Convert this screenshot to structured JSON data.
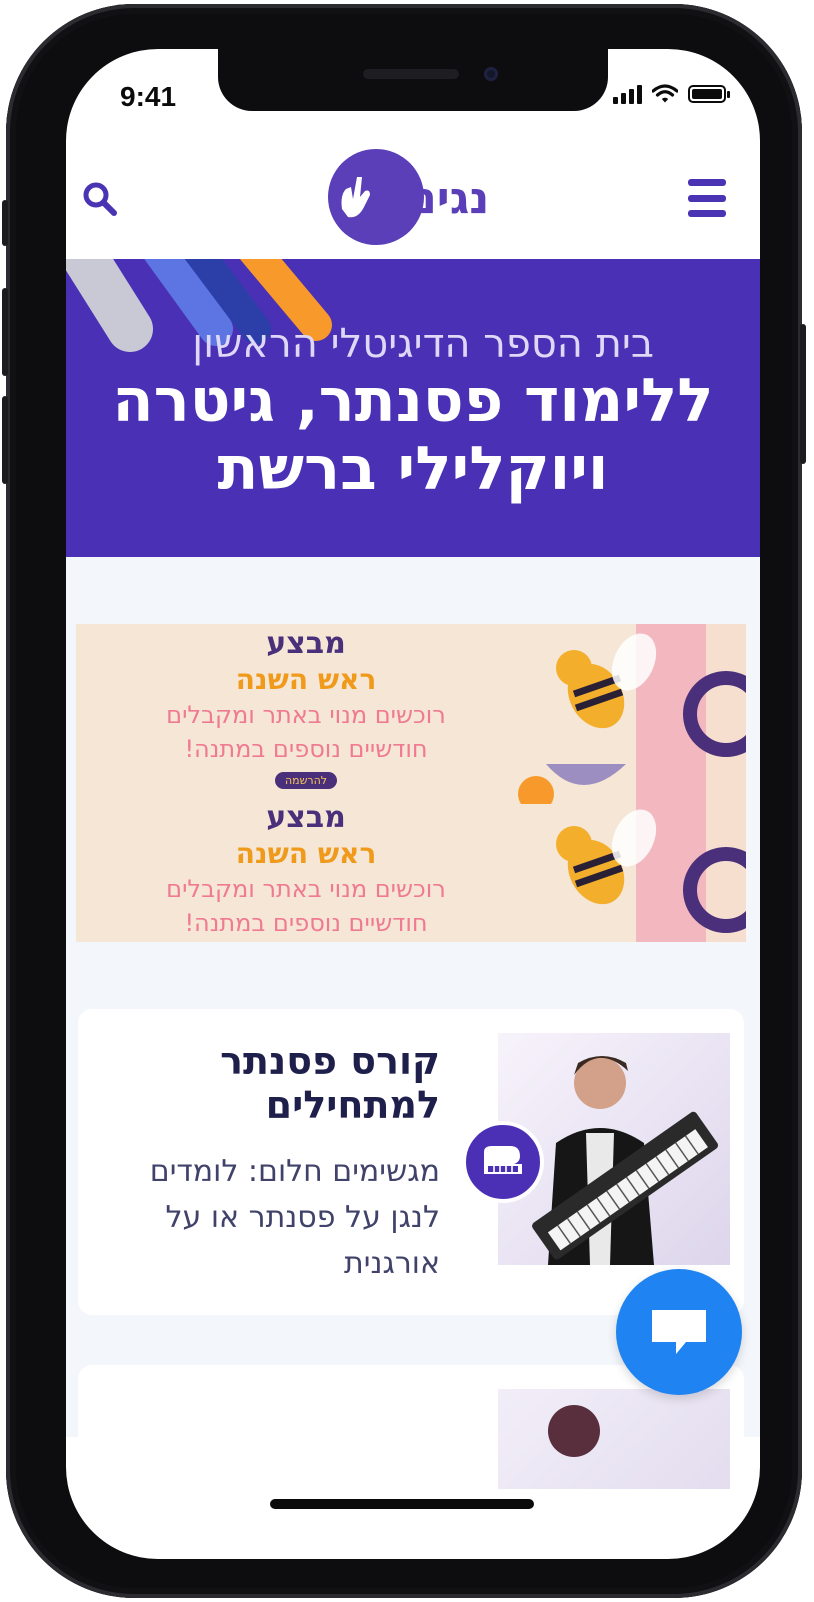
{
  "status_bar": {
    "time": "9:41"
  },
  "header": {
    "logo_text": "נגינה"
  },
  "hero": {
    "subtitle": "בית הספר הדיגיטלי הראשון",
    "title_line1": "ללימוד פסנתר, גיטרה",
    "title_line2": "ויוקלילי ברשת"
  },
  "promo": {
    "heading": "מבצע",
    "subheading": "ראש השנה",
    "line1": "רוכשים מנוי באתר ומקבלים",
    "line2": "חודשיים נוספים במתנה!",
    "button_label": "להרשמה"
  },
  "course_card": {
    "title": "קורס פסנתר למתחילים",
    "description": "מגשימים חלום: לומדים לנגן על פסנתר או על אורגנית"
  },
  "colors": {
    "brand_purple": "#4a30b5",
    "chat_blue": "#1f84f2",
    "promo_bg": "#f5e6d6"
  }
}
